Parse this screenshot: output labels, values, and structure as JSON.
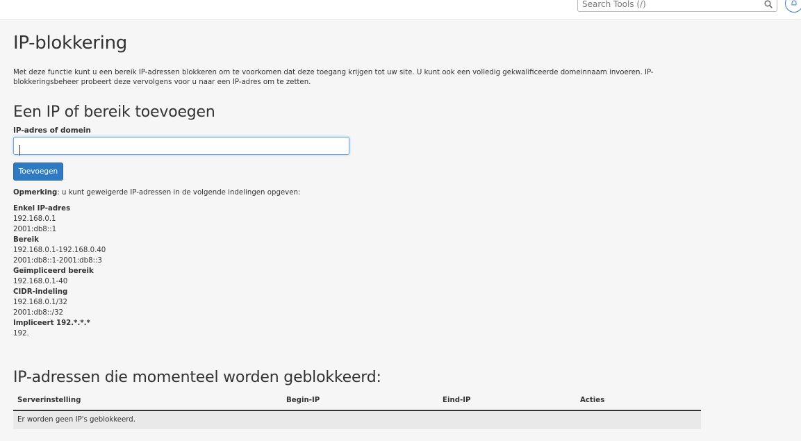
{
  "header": {
    "search_placeholder": "Search Tools (/)",
    "icons": [
      "search-icon",
      "bell-icon"
    ]
  },
  "page": {
    "title": "IP-blokkering",
    "intro": "Met deze functie kunt u een bereik IP-adressen blokkeren om te voorkomen dat deze toegang krijgen tot uw site. U kunt ook een volledig gekwalificeerde domeinnaam invoeren. IP-blokkeringsbeheer probeert deze vervolgens voor u naar een IP-adres om te zetten."
  },
  "add_section": {
    "title": "Een IP of bereik toevoegen",
    "field_label": "IP-adres of domein",
    "field_value": "",
    "button_label": "Toevoegen",
    "note_label": "Opmerking",
    "note_text": ": u kunt geweigerde IP-adressen in de volgende indelingen opgeven:"
  },
  "formats": [
    {
      "title": "Enkel IP-adres",
      "examples": [
        "192.168.0.1",
        "2001:db8::1"
      ]
    },
    {
      "title": "Bereik",
      "examples": [
        "192.168.0.1-192.168.0.40",
        "2001:db8::1-2001:db8::3"
      ]
    },
    {
      "title": "Geïmpliceerd bereik",
      "examples": [
        "192.168.0.1-40"
      ]
    },
    {
      "title": "CIDR-indeling",
      "examples": [
        "192.168.0.1/32",
        "2001:db8::/32"
      ]
    },
    {
      "title": "Impliceert 192.*.*.*",
      "examples": [
        "192."
      ]
    }
  ],
  "blocked_section": {
    "title": "IP-adressen die momenteel worden geblokkeerd:",
    "columns": [
      "Serverinstelling",
      "Begin-IP",
      "Eind-IP",
      "Acties"
    ],
    "empty_message": "Er worden geen IP's geblokkeerd."
  },
  "colors": {
    "primary_button": "#2f7ac1",
    "input_focus_border": "#67a8e0",
    "page_background": "#f6f6f6"
  }
}
